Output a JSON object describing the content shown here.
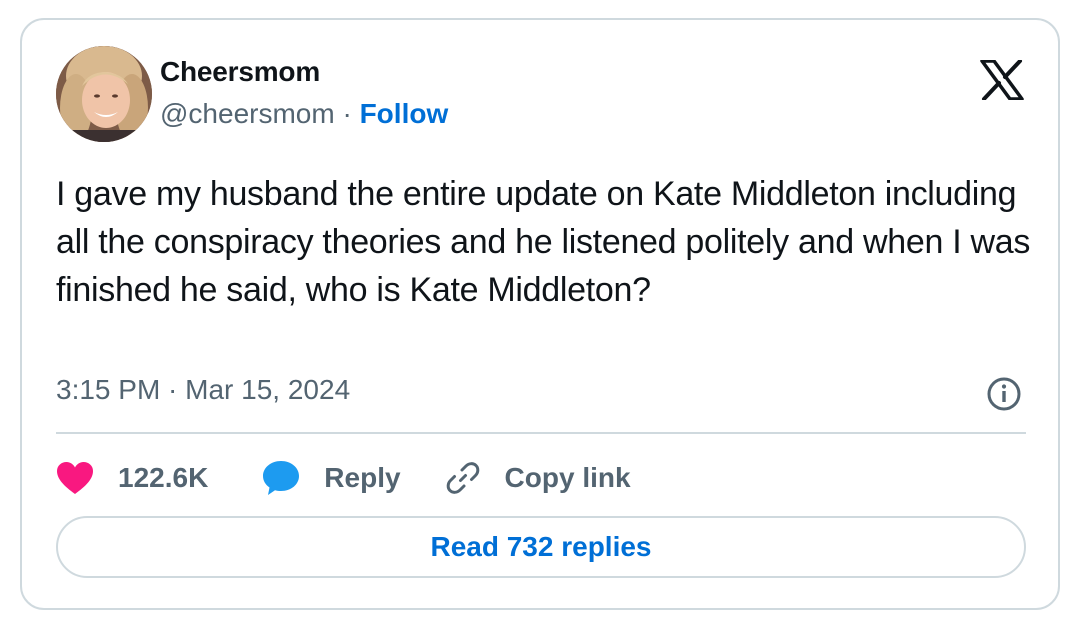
{
  "author": {
    "display_name": "Cheersmom",
    "handle": "@cheersmom",
    "separator": "·",
    "follow_label": "Follow"
  },
  "tweet": {
    "text": "I gave my husband the entire update on Kate Middleton including all the conspiracy theories and he listened politely and when I was finished he said, who is Kate Middleton?",
    "timestamp": "3:15 PM · Mar 15, 2024"
  },
  "actions": {
    "like_count": "122.6K",
    "reply_label": "Reply",
    "copy_link_label": "Copy link"
  },
  "read_replies_label": "Read 732 replies",
  "icons": {
    "brand": "x-logo-icon",
    "info": "info-icon",
    "like": "heart-icon",
    "reply": "speech-bubble-icon",
    "copy": "link-icon"
  },
  "colors": {
    "link_blue": "#006fd6",
    "heart": "#f91880",
    "reply_blue": "#1d9bf0",
    "muted": "#536471",
    "border": "#cfd9de"
  }
}
